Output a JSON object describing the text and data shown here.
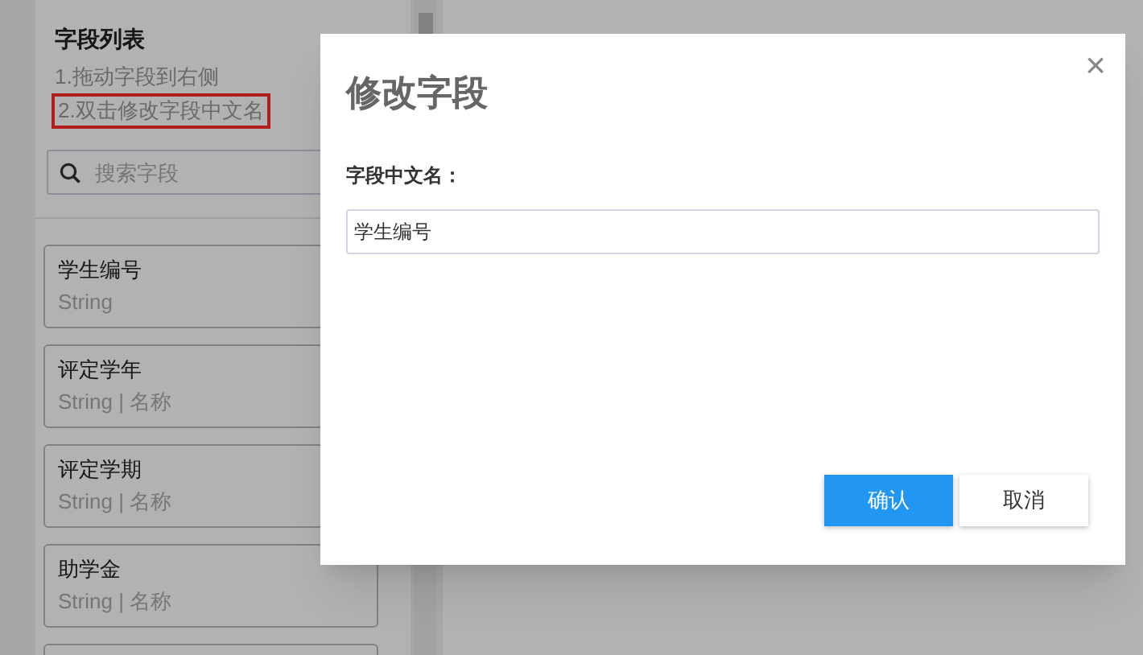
{
  "sidebar": {
    "title": "字段列表",
    "hints": [
      {
        "text": "1.拖动字段到右侧",
        "highlighted": false
      },
      {
        "text": "2.双击修改字段中文名",
        "highlighted": true
      }
    ],
    "search": {
      "placeholder": "搜索字段"
    },
    "fields": [
      {
        "name": "学生编号",
        "type": "String"
      },
      {
        "name": "评定学年",
        "type": "String | 名称"
      },
      {
        "name": "评定学期",
        "type": "String | 名称"
      },
      {
        "name": "助学金",
        "type": "String | 名称"
      }
    ]
  },
  "dialog": {
    "title": "修改字段",
    "close": "×",
    "label": "字段中文名：",
    "value": "学生编号",
    "buttons": [
      {
        "label": "确认",
        "kind": "primary"
      },
      {
        "label": "取消",
        "kind": "secondary"
      }
    ]
  }
}
